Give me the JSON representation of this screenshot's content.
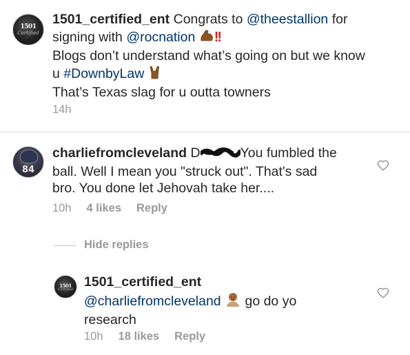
{
  "comment1": {
    "username": "1501_certified_ent",
    "text_before_mention": " Congrats to ",
    "mention1": "@theestallion",
    "text_after_mention1": " for",
    "line2_prefix": "signing with ",
    "mention2": "@rocnation",
    "emoji_flex": "flexed-biceps-emoji",
    "emoji_exclaim": "!!",
    "line3": "Blogs don’t understand what’s going on but we know",
    "line4_prefix": "u ",
    "hashtag": "#DownbyLaw",
    "emoji_horns": "sign-of-horns-emoji",
    "line5": "That’s Texas slag for u outta towners",
    "time": "14h"
  },
  "comment2": {
    "username": "charliefromcleveland",
    "text_prefix": " D",
    "text_redacted_icon": "scribble-redaction",
    "text_line1_rest": "You fumbled the",
    "line2": "ball. Well I mean you \"struck out\". That's sad",
    "line3": "bro. You done let Jehovah take her....",
    "time": "10h",
    "likes": "4 likes",
    "reply": "Reply",
    "avatar_number": "84"
  },
  "hide_replies": "Hide replies",
  "reply1": {
    "username": "1501_certified_ent",
    "mention": "@charliefromcleveland",
    "emoji": "person-shrugging-emoji",
    "text_after": " go do yo",
    "line3": "research",
    "time": "10h",
    "likes": "18 likes",
    "reply": "Reply"
  },
  "avatar_logo": {
    "line1": "1501",
    "line2": "Certified"
  },
  "colors": {
    "text": "#262626",
    "link": "#003569",
    "meta": "#999999",
    "divider": "#dbdbdb"
  }
}
